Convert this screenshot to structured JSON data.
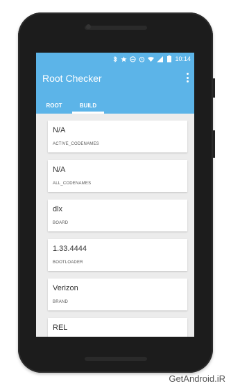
{
  "status_bar": {
    "time": "10:14",
    "icons": [
      "bluetooth-icon",
      "star-icon",
      "do-not-disturb-icon",
      "alarm-icon",
      "wifi-icon",
      "signal-icon",
      "battery-icon"
    ]
  },
  "app_bar": {
    "title": "Root Checker",
    "menu_icon": "overflow-menu-icon",
    "color": "#5cb4e8"
  },
  "tabs": [
    {
      "label": "ROOT",
      "active": false
    },
    {
      "label": "BUILD",
      "active": true
    }
  ],
  "build_items": [
    {
      "value": "N/A",
      "label": "ACTIVE_CODENAMES"
    },
    {
      "value": "N/A",
      "label": "ALL_CODENAMES"
    },
    {
      "value": "dlx",
      "label": "BOARD"
    },
    {
      "value": "1.33.4444",
      "label": "BOOTLOADER"
    },
    {
      "value": "Verizon",
      "label": "BRAND"
    },
    {
      "value": "REL",
      "label": ""
    }
  ],
  "watermark": "GetAndroid.iR"
}
